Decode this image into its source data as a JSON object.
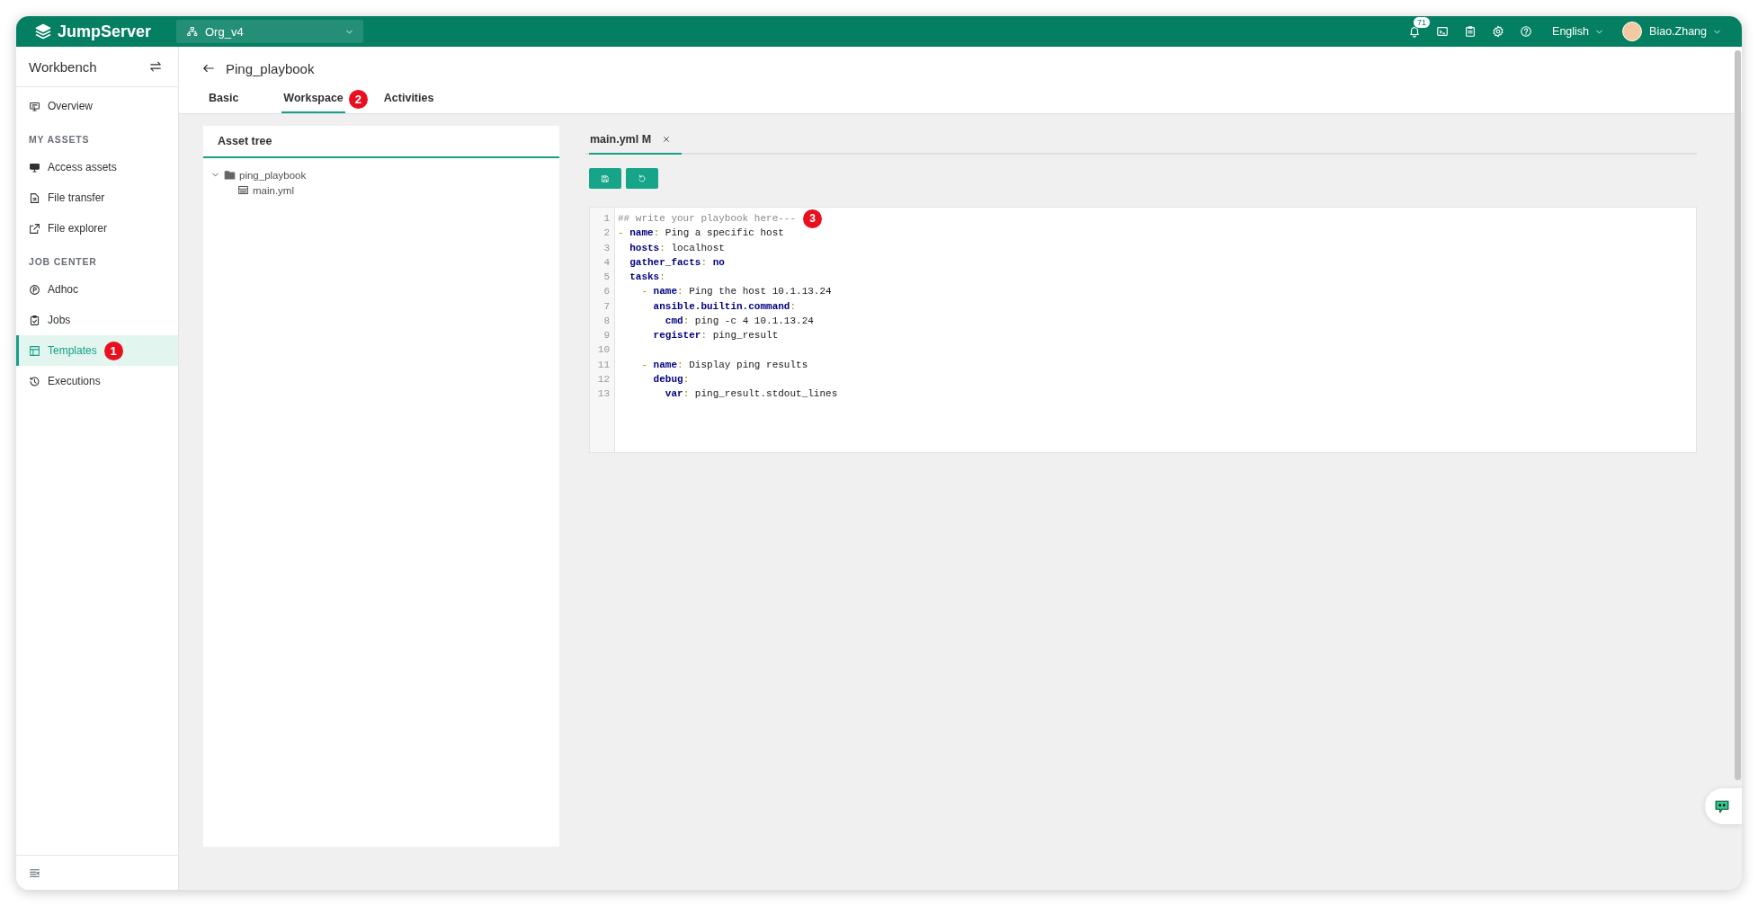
{
  "topbar": {
    "logo": "JumpServer",
    "org": "Org_v4",
    "notifications": "71",
    "language": "English",
    "user": "Biao.Zhang"
  },
  "sidebar": {
    "title": "Workbench",
    "groups": [
      {
        "items": [
          {
            "label": "Overview",
            "selected": false
          }
        ]
      },
      {
        "heading": "MY ASSETS",
        "items": [
          {
            "label": "Access assets",
            "selected": false
          },
          {
            "label": "File transfer",
            "selected": false
          },
          {
            "label": "File explorer",
            "selected": false
          }
        ]
      },
      {
        "heading": "JOB CENTER",
        "items": [
          {
            "label": "Adhoc",
            "selected": false
          },
          {
            "label": "Jobs",
            "selected": false
          },
          {
            "label": "Templates",
            "selected": true,
            "marker": "1"
          },
          {
            "label": "Executions",
            "selected": false
          }
        ]
      }
    ]
  },
  "page": {
    "title": "Ping_playbook",
    "tabs": [
      {
        "label": "Basic",
        "selected": false
      },
      {
        "label": "Workspace",
        "selected": true,
        "marker": "2"
      },
      {
        "label": "Activities",
        "selected": false
      }
    ]
  },
  "asset_tree": {
    "title": "Asset tree",
    "nodes": [
      {
        "label": "ping_playbook",
        "kind": "folder",
        "expanded": true,
        "children": [
          {
            "label": "main.yml",
            "kind": "file"
          }
        ]
      }
    ]
  },
  "editor": {
    "tabs": [
      {
        "label": "main.yml M",
        "selected": true
      }
    ],
    "marker": "3",
    "lines": [
      {
        "number": "1",
        "tokens": [
          {
            "kind": "comment",
            "text": "## write your playbook here---"
          }
        ]
      },
      {
        "number": "2",
        "tokens": [
          {
            "kind": "dash",
            "text": "-"
          },
          {
            "kind": "key",
            "text": " name"
          },
          {
            "kind": "colon",
            "text": ":"
          },
          {
            "kind": "text",
            "text": " Ping a specific host"
          }
        ]
      },
      {
        "number": "3",
        "tokens": [
          {
            "kind": "key",
            "text": "  hosts"
          },
          {
            "kind": "colon",
            "text": ":"
          },
          {
            "kind": "text",
            "text": " localhost"
          }
        ]
      },
      {
        "number": "4",
        "tokens": [
          {
            "kind": "key",
            "text": "  gather_facts"
          },
          {
            "kind": "colon",
            "text": ":"
          },
          {
            "kind": "keyword",
            "text": " no"
          }
        ]
      },
      {
        "number": "5",
        "tokens": [
          {
            "kind": "key",
            "text": "  tasks"
          },
          {
            "kind": "colon",
            "text": ":"
          }
        ]
      },
      {
        "number": "6",
        "tokens": [
          {
            "kind": "dash",
            "text": "    -"
          },
          {
            "kind": "key",
            "text": " name"
          },
          {
            "kind": "colon",
            "text": ":"
          },
          {
            "kind": "text",
            "text": " Ping the host 10.1.13.24"
          }
        ]
      },
      {
        "number": "7",
        "tokens": [
          {
            "kind": "key",
            "text": "      ansible.builtin.command"
          },
          {
            "kind": "colon",
            "text": ":"
          }
        ]
      },
      {
        "number": "8",
        "tokens": [
          {
            "kind": "key",
            "text": "        cmd"
          },
          {
            "kind": "colon",
            "text": ":"
          },
          {
            "kind": "text",
            "text": " ping -c 4 10.1.13.24"
          }
        ]
      },
      {
        "number": "9",
        "tokens": [
          {
            "kind": "key",
            "text": "      register"
          },
          {
            "kind": "colon",
            "text": ":"
          },
          {
            "kind": "text",
            "text": " ping_result"
          }
        ]
      },
      {
        "number": "10"
      },
      {
        "number": "11",
        "tokens": [
          {
            "kind": "dash",
            "text": "    -"
          },
          {
            "kind": "key",
            "text": " name"
          },
          {
            "kind": "colon",
            "text": ":"
          },
          {
            "kind": "text",
            "text": " Display ping results"
          }
        ]
      },
      {
        "number": "12",
        "tokens": [
          {
            "kind": "key",
            "text": "      debug"
          },
          {
            "kind": "colon",
            "text": ":"
          }
        ]
      },
      {
        "number": "13",
        "tokens": [
          {
            "kind": "key",
            "text": "        var"
          },
          {
            "kind": "colon",
            "text": ":"
          },
          {
            "kind": "text",
            "text": " ping_result.stdout_lines"
          }
        ]
      }
    ]
  }
}
